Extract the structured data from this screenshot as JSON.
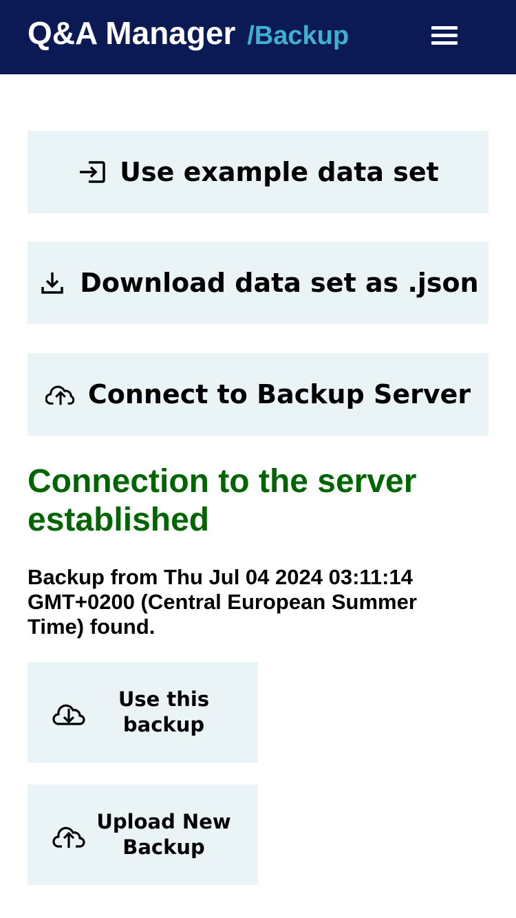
{
  "header": {
    "app_title": "Q&A Manager",
    "section": "/Backup",
    "background_color": "#0b1a54",
    "section_color": "#3fb0d0",
    "menu_icon": "hamburger-menu-icon"
  },
  "actions": [
    {
      "label": "Use example data set",
      "icon": "import-icon"
    },
    {
      "label": "Download data set as .json",
      "icon": "download-icon"
    },
    {
      "label": "Connect to Backup Server",
      "icon": "cloud-upload-icon"
    }
  ],
  "status": {
    "heading": "Connection to the server established",
    "heading_color": "#006400",
    "backup_info": "Backup from Thu Jul 04 2024 03:11:14 GMT+0200 (Central European Summer Time) found."
  },
  "backup_actions": [
    {
      "label": "Use this backup",
      "icon": "cloud-download-icon"
    },
    {
      "label": "Upload New Backup",
      "icon": "cloud-upload-icon"
    }
  ],
  "colors": {
    "button_background": "#eaf4f7"
  }
}
